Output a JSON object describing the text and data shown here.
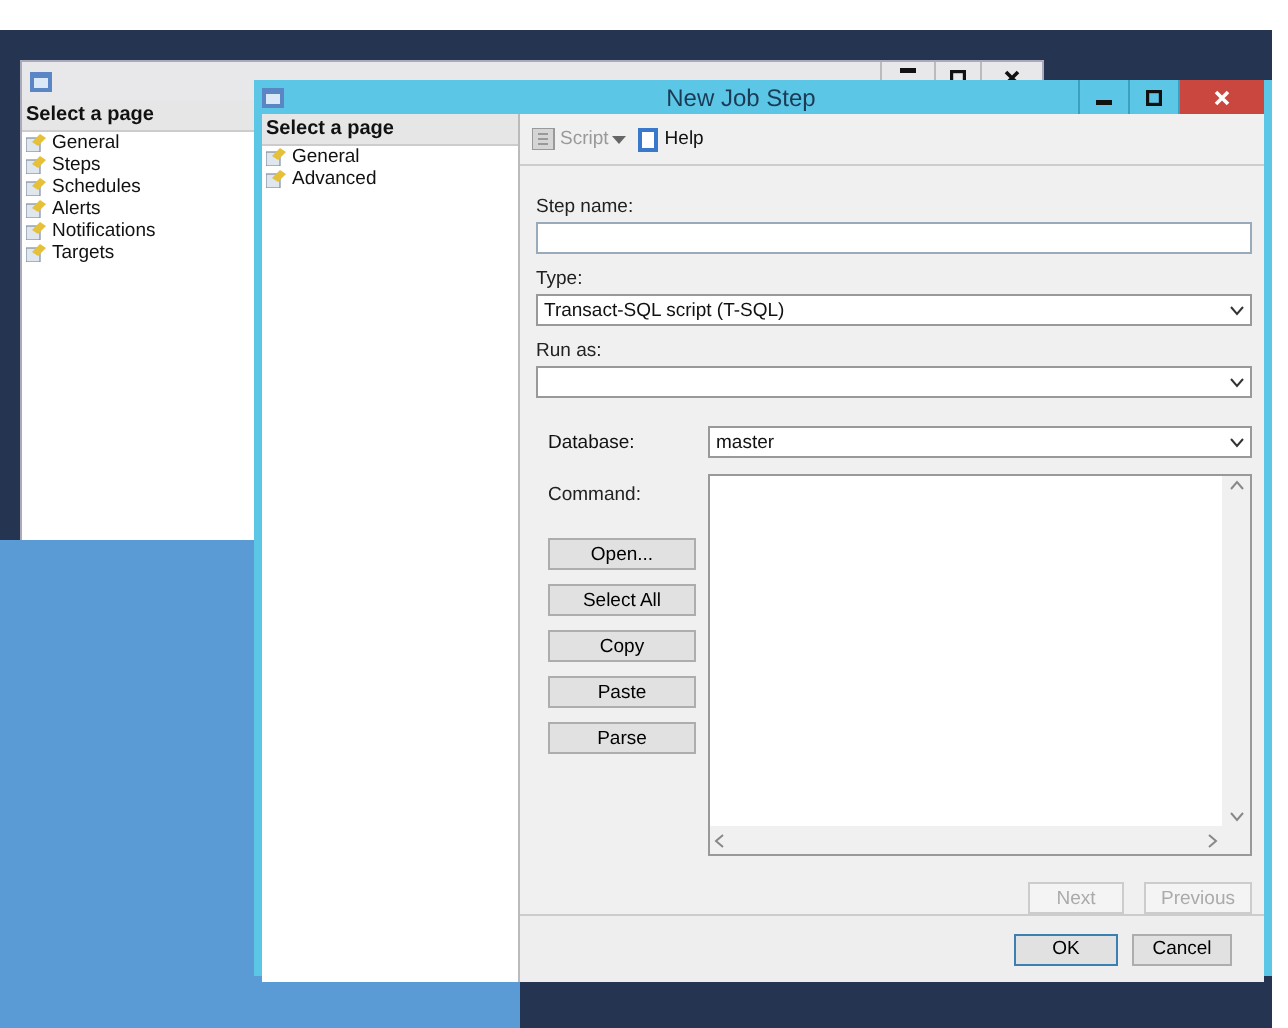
{
  "background_window": {
    "pages_header": "Select a page",
    "pages": [
      {
        "label": "General"
      },
      {
        "label": "Steps"
      },
      {
        "label": "Schedules"
      },
      {
        "label": "Alerts"
      },
      {
        "label": "Notifications"
      },
      {
        "label": "Targets"
      }
    ]
  },
  "dialog": {
    "title": "New Job Step",
    "pages_header": "Select a page",
    "pages": [
      {
        "label": "General"
      },
      {
        "label": "Advanced"
      }
    ],
    "toolbar": [
      {
        "label": "Script",
        "kind": "dropdown",
        "disabled": true
      },
      {
        "label": "Help",
        "kind": "button",
        "disabled": false
      }
    ],
    "step_name": {
      "label": "Step name:"
    },
    "type": {
      "label": "Type:",
      "value": "Transact-SQL script (T-SQL)"
    },
    "run_as": {
      "label": "Run as:"
    },
    "database": {
      "label": "Database:",
      "value": "master"
    },
    "command": {
      "label": "Command:"
    },
    "command_buttons": [
      {
        "label": "Open..."
      },
      {
        "label": "Select All"
      },
      {
        "label": "Copy"
      },
      {
        "label": "Paste"
      },
      {
        "label": "Parse"
      }
    ],
    "nav_buttons": [
      {
        "label": "Next",
        "disabled": true
      },
      {
        "label": "Previous",
        "disabled": true
      }
    ],
    "footer_buttons": [
      {
        "label": "OK",
        "default": true
      },
      {
        "label": "Cancel",
        "default": false
      }
    ]
  }
}
